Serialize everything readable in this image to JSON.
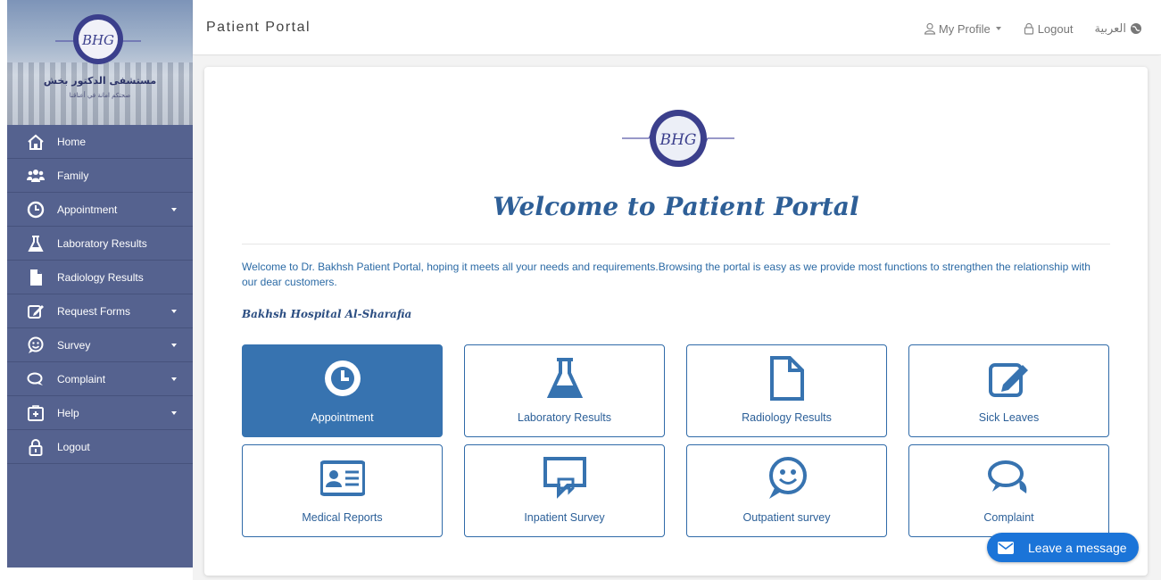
{
  "header": {
    "title": "Patient Portal",
    "profile_label": "My Profile",
    "logout_label": "Logout",
    "language_label": "العربية"
  },
  "sidebar": {
    "hospital_name_ar": "مستشفى الدكتور بخش",
    "tagline_ar": "صحتكم امانة في أعناقنا",
    "logo_text": "BHG",
    "items": [
      {
        "label": "Home",
        "icon": "home-icon",
        "has_submenu": false
      },
      {
        "label": "Family",
        "icon": "users-icon",
        "has_submenu": false
      },
      {
        "label": "Appointment",
        "icon": "clock-icon",
        "has_submenu": true
      },
      {
        "label": "Laboratory Results",
        "icon": "flask-icon",
        "has_submenu": false
      },
      {
        "label": "Radiology Results",
        "icon": "file-icon",
        "has_submenu": false
      },
      {
        "label": "Request Forms",
        "icon": "edit-icon",
        "has_submenu": true
      },
      {
        "label": "Survey",
        "icon": "smile-icon",
        "has_submenu": true
      },
      {
        "label": "Complaint",
        "icon": "chat-icon",
        "has_submenu": true
      },
      {
        "label": "Help",
        "icon": "medkit-icon",
        "has_submenu": true
      },
      {
        "label": "Logout",
        "icon": "lock-icon",
        "has_submenu": false
      }
    ]
  },
  "main": {
    "logo_text": "BHG",
    "welcome_title": "Welcome to Patient Portal",
    "intro_text": "Welcome to Dr. Bakhsh Patient Portal, hoping it meets all your needs and requirements.Browsing the portal is easy as we provide most functions to strengthen the relationship with our dear customers.",
    "hospital_name": "Bakhsh Hospital Al-Sharafia",
    "tiles": [
      {
        "label": "Appointment",
        "icon": "clock-icon",
        "active": true
      },
      {
        "label": "Laboratory Results",
        "icon": "flask-icon",
        "active": false
      },
      {
        "label": "Radiology Results",
        "icon": "file-icon",
        "active": false
      },
      {
        "label": "Sick Leaves",
        "icon": "edit-icon",
        "active": false
      },
      {
        "label": "Medical Reports",
        "icon": "id-card-icon",
        "active": false
      },
      {
        "label": "Inpatient Survey",
        "icon": "comments-icon",
        "active": false
      },
      {
        "label": "Outpatient survey",
        "icon": "smile-chat-icon",
        "active": false
      },
      {
        "label": "Complaint",
        "icon": "speech-bubbles-icon",
        "active": false
      }
    ]
  },
  "chat_widget": {
    "label": "Leave a message",
    "icon": "envelope-icon"
  },
  "colors": {
    "sidebar_bg": "#55628f",
    "primary_blue": "#3773b0",
    "tile_text": "#2b5f98",
    "chat_blue": "#1b74d8"
  }
}
